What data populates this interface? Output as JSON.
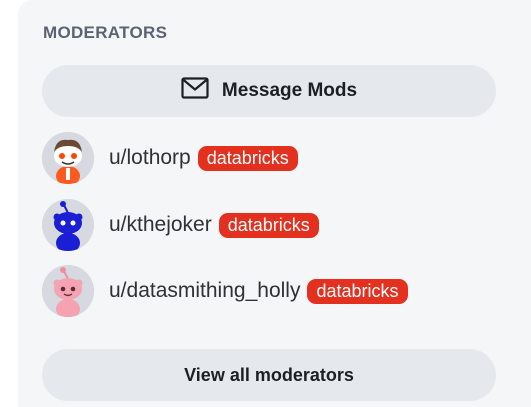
{
  "moderators_widget": {
    "heading": "MODERATORS",
    "message_button_label": "Message Mods",
    "message_icon": "mail-icon",
    "view_all_label": "View all moderators",
    "moderators": [
      {
        "username": "u/lothorp",
        "flair": "databricks",
        "avatar": "snoo-avatar-orange"
      },
      {
        "username": "u/kthejoker",
        "flair": "databricks",
        "avatar": "snoo-avatar-blue"
      },
      {
        "username": "u/datasmithing_holly",
        "flair": "databricks",
        "avatar": "snoo-avatar-pink"
      }
    ]
  },
  "colors": {
    "panel_bg": "#f5f6f8",
    "button_bg": "#e5e8ed",
    "flair_bg": "#e3301f",
    "heading": "#5b6373"
  }
}
